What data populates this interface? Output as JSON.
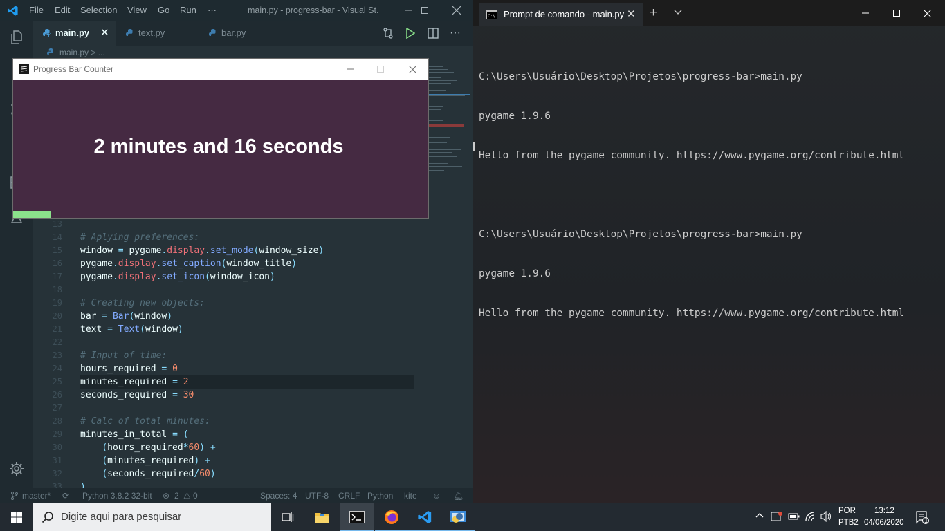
{
  "vscode": {
    "menu": [
      "File",
      "Edit",
      "Selection",
      "View",
      "Go",
      "Run",
      "···"
    ],
    "window_title": "main.py - progress-bar - Visual St...",
    "tabs": [
      {
        "label": "main.py",
        "active": true
      },
      {
        "label": "text.py",
        "active": false
      },
      {
        "label": "bar.py",
        "active": false
      }
    ],
    "breadcrumb": "main.py > ...",
    "code_lines": [
      {
        "n": "13",
        "html": ""
      },
      {
        "n": "14",
        "html": "<span class='c-com'># Aplying preferences:</span>"
      },
      {
        "n": "15",
        "html": "window <span class='c-op'>=</span> pygame<span class='c-op'>.</span><span class='c-mod'>display</span><span class='c-op'>.</span><span class='c-fn'>set_mode</span><span class='c-op'>(</span>window_size<span class='c-op'>)</span>"
      },
      {
        "n": "16",
        "html": "pygame<span class='c-op'>.</span><span class='c-mod'>display</span><span class='c-op'>.</span><span class='c-fn'>set_caption</span><span class='c-op'>(</span>window_title<span class='c-op'>)</span>"
      },
      {
        "n": "17",
        "html": "pygame<span class='c-op'>.</span><span class='c-mod'>display</span><span class='c-op'>.</span><span class='c-fn'>set_icon</span><span class='c-op'>(</span>window_icon<span class='c-op'>)</span>"
      },
      {
        "n": "18",
        "html": ""
      },
      {
        "n": "19",
        "html": "<span class='c-com'># Creating new objects:</span>"
      },
      {
        "n": "20",
        "html": "bar <span class='c-op'>=</span> <span class='c-fn'>Bar</span><span class='c-op'>(</span>window<span class='c-op'>)</span>"
      },
      {
        "n": "21",
        "html": "text <span class='c-op'>=</span> <span class='c-fn'>Text</span><span class='c-op'>(</span>window<span class='c-op'>)</span>"
      },
      {
        "n": "22",
        "html": ""
      },
      {
        "n": "23",
        "html": "<span class='c-com'># Input of time:</span>"
      },
      {
        "n": "24",
        "html": "hours_required <span class='c-op'>=</span> <span class='c-num'>0</span>"
      },
      {
        "n": "25",
        "html": "minutes_required <span class='c-op'>=</span> <span class='c-num'>2</span>"
      },
      {
        "n": "26",
        "html": "seconds_required <span class='c-op'>=</span> <span class='c-num'>30</span>"
      },
      {
        "n": "27",
        "html": ""
      },
      {
        "n": "28",
        "html": "<span class='c-com'># Calc of total minutes:</span>"
      },
      {
        "n": "29",
        "html": "minutes_in_total <span class='c-op'>=</span> <span class='c-op'>(</span>"
      },
      {
        "n": "30",
        "html": "    <span class='c-op'>(</span>hours_required<span class='c-op'>*</span><span class='c-num'>60</span><span class='c-op'>)</span> <span class='c-op'>+</span>"
      },
      {
        "n": "31",
        "html": "    <span class='c-op'>(</span>minutes_required<span class='c-op'>)</span> <span class='c-op'>+</span>"
      },
      {
        "n": "32",
        "html": "    <span class='c-op'>(</span>seconds_required<span class='c-op'>/</span><span class='c-num'>60</span><span class='c-op'>)</span>"
      },
      {
        "n": "33",
        "html": "<span class='c-op'>)</span>"
      }
    ],
    "status": {
      "branch": "master*",
      "python": "Python 3.8.2 32-bit",
      "problems": "2",
      "warnings": "0",
      "spaces": "Spaces: 4",
      "encoding": "UTF-8",
      "eol": "CRLF",
      "language": "Python",
      "linter": "kite"
    }
  },
  "pygame_window": {
    "title": "Progress Bar Counter",
    "text": "2 minutes and 16 seconds",
    "progress_fraction": 0.09,
    "bar_color": "#8be28b",
    "bg_color": "#452a42"
  },
  "cmd": {
    "tab_title": "Prompt de comando - main.py",
    "lines": [
      "C:\\Users\\Usuário\\Desktop\\Projetos\\progress-bar>main.py",
      "pygame 1.9.6",
      "Hello from the pygame community. https://www.pygame.org/contribute.html",
      "",
      "C:\\Users\\Usuário\\Desktop\\Projetos\\progress-bar>main.py",
      "pygame 1.9.6",
      "Hello from the pygame community. https://www.pygame.org/contribute.html"
    ]
  },
  "taskbar": {
    "search_placeholder": "Digite aqui para pesquisar",
    "language": "POR",
    "keyboard": "PTB2",
    "time": "13:12",
    "date": "04/06/2020",
    "notifications": "1"
  }
}
